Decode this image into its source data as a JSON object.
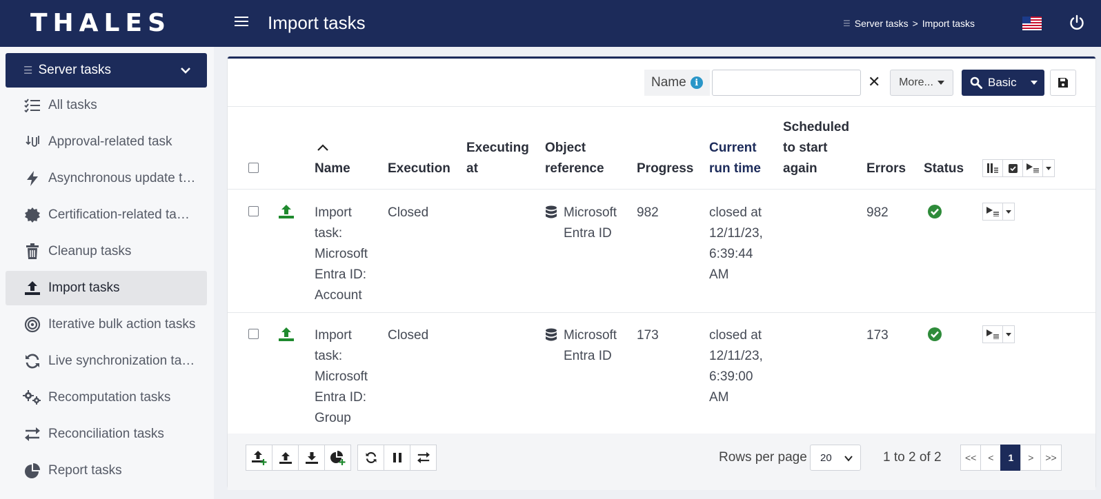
{
  "header": {
    "logo": "THALES",
    "title": "Import tasks",
    "breadcrumb": [
      "Server tasks",
      "Import tasks"
    ],
    "breadcrumb_sep": ">"
  },
  "sidebar": {
    "group_label": "Server tasks",
    "items": [
      {
        "label": "All tasks",
        "icon": "list-check-icon"
      },
      {
        "label": "Approval-related task",
        "icon": "approval-icon"
      },
      {
        "label": "Asynchronous update tasks",
        "icon": "bolt-icon"
      },
      {
        "label": "Certification-related tasks",
        "icon": "certificate-icon"
      },
      {
        "label": "Cleanup tasks",
        "icon": "trash-icon"
      },
      {
        "label": "Import tasks",
        "icon": "upload-icon",
        "active": true
      },
      {
        "label": "Iterative bulk action tasks",
        "icon": "target-icon"
      },
      {
        "label": "Live synchronization tasks",
        "icon": "sync-icon"
      },
      {
        "label": "Recomputation tasks",
        "icon": "gears-icon"
      },
      {
        "label": "Reconciliation tasks",
        "icon": "arrows-exchange-icon"
      },
      {
        "label": "Report tasks",
        "icon": "pie-chart-icon"
      }
    ]
  },
  "filter": {
    "name_label": "Name",
    "name_value": "",
    "more_label": "More...",
    "search_label": "Basic"
  },
  "table": {
    "columns": {
      "name": "Name",
      "execution": "Execution",
      "executing_at": [
        "Executing",
        "at"
      ],
      "object_reference": [
        "Object",
        "reference"
      ],
      "progress": "Progress",
      "current_run_time": [
        "Current",
        "run time"
      ],
      "scheduled": [
        "Scheduled",
        "to start",
        "again"
      ],
      "errors": "Errors",
      "status": "Status"
    },
    "rows": [
      {
        "name": [
          "Import",
          "task:",
          "Microsoft",
          "Entra ID:",
          "Account"
        ],
        "execution": "Closed",
        "executing_at": "",
        "object_reference": [
          "Microsoft",
          "Entra ID"
        ],
        "progress": "982",
        "current_run_time": [
          "closed at",
          "12/11/23,",
          "6:39:44",
          "AM"
        ],
        "scheduled": "",
        "errors": "982",
        "status": "success"
      },
      {
        "name": [
          "Import",
          "task:",
          "Microsoft",
          "Entra ID:",
          "Group"
        ],
        "execution": "Closed",
        "executing_at": "",
        "object_reference": [
          "Microsoft",
          "Entra ID"
        ],
        "progress": "173",
        "current_run_time": [
          "closed at",
          "12/11/23,",
          "6:39:00",
          "AM"
        ],
        "scheduled": "",
        "errors": "173",
        "status": "success"
      }
    ]
  },
  "footer": {
    "rows_per_page_label": "Rows per page",
    "rows_per_page": "20",
    "range": "1 to 2 of 2",
    "pager": {
      "first": "<<",
      "prev": "<",
      "current": "1",
      "next": ">",
      "last": ">>"
    }
  },
  "colors": {
    "primary": "#1c2b5a",
    "success": "#2e8b3a",
    "import_green": "#1f8a2e",
    "info": "#2a96c8"
  }
}
